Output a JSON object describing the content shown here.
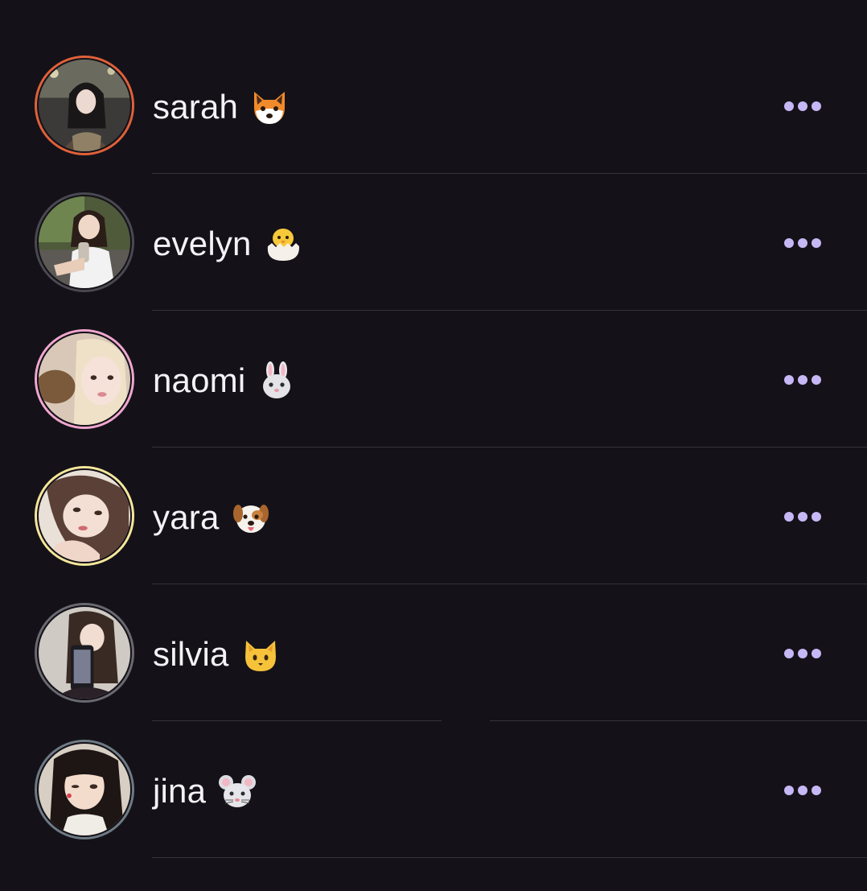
{
  "colors": {
    "background": "#141218",
    "text": "#f4f2f7",
    "more_dots": "#c6b8f5",
    "divider": "#35323b"
  },
  "rows": [
    {
      "name": "sarah",
      "emoji": "fox-face",
      "ring_color": "#e0603a",
      "more_icon": "more-horizontal-icon"
    },
    {
      "name": "evelyn",
      "emoji": "hatching-chick",
      "ring_color": "#4a4850",
      "more_icon": "more-horizontal-icon"
    },
    {
      "name": "naomi",
      "emoji": "rabbit-face",
      "ring_color": "#f0a6cf",
      "more_icon": "more-horizontal-icon"
    },
    {
      "name": "yara",
      "emoji": "dog-face",
      "ring_color": "#f6e79a",
      "more_icon": "more-horizontal-icon"
    },
    {
      "name": "silvia",
      "emoji": "cat-face",
      "ring_color": "#6a6870",
      "more_icon": "more-horizontal-icon"
    },
    {
      "name": "jina",
      "emoji": "mouse-face",
      "ring_color": "#6e7a84",
      "more_icon": "more-horizontal-icon"
    }
  ]
}
